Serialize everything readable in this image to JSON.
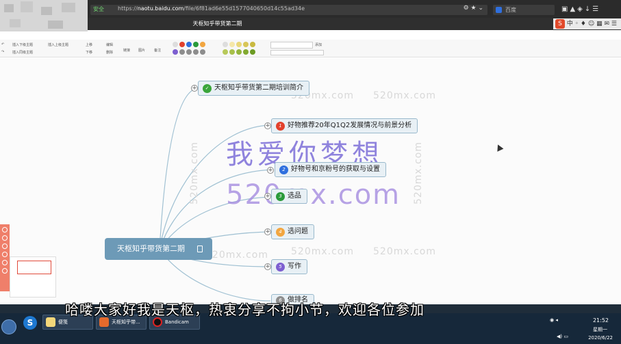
{
  "browser": {
    "secure_label": "安全",
    "url_host": "naotu.baidu.com",
    "url_path": "/file/6f81ad6e55d1577040650d14c55ad34e",
    "url_prefix": "https://",
    "search_engine": "百度",
    "tab_title": "天枢知乎带货第二期"
  },
  "ime": {
    "logo": "S",
    "mode": "中"
  },
  "toolbar": {
    "insert_child": "插入下级主题",
    "insert_parent": "插入上级主题",
    "insert_sibling": "插入同级主题",
    "move_up": "上移",
    "move_down": "下移",
    "edit": "编辑",
    "delete": "删除",
    "link": "链接",
    "image": "图片",
    "note": "备注",
    "add_label": "添加",
    "priority_numbers": [
      "1",
      "2",
      "3",
      "4",
      "5",
      "6",
      "7",
      "8",
      "9"
    ]
  },
  "mindmap": {
    "root": "天枢知乎带货第二期",
    "nodes": [
      {
        "label": "天枢知乎带货第二期培训简介",
        "icon": "check-icon",
        "priority": ""
      },
      {
        "label": "好物推荐20年Q1Q2发展情况与前景分析",
        "icon": "priority-icon",
        "priority": "1"
      },
      {
        "label": "好物号和京粉号的获取与设置",
        "icon": "priority-icon",
        "priority": "2"
      },
      {
        "label": "选品",
        "icon": "priority-icon",
        "priority": "3"
      },
      {
        "label": "选问题",
        "icon": "priority-icon",
        "priority": "4"
      },
      {
        "label": "写作",
        "icon": "priority-icon",
        "priority": "5"
      },
      {
        "label": "做排名",
        "icon": "priority-icon",
        "priority": "6"
      }
    ],
    "colors": {
      "p1": "#e2412c",
      "p2": "#2f6fde",
      "p3": "#2a9a3a",
      "p4": "#f2a640",
      "p5": "#7d5fd0",
      "p6": "#8d8d8d",
      "check": "#3aa53a"
    }
  },
  "watermarks": {
    "small": "520mx.com",
    "big_cn": "我爱你梦想",
    "big_en": "520mx.com"
  },
  "subtitle": "哈喽大家好我是天枢，热衷分享不拘小节，欢迎各位参加",
  "taskbar": {
    "items": [
      {
        "label": "便笺"
      },
      {
        "label": "天枢知乎带..."
      },
      {
        "label": "Bandicam"
      }
    ],
    "time": "21:52",
    "weekday": "星期一",
    "date": "2020/6/22"
  }
}
